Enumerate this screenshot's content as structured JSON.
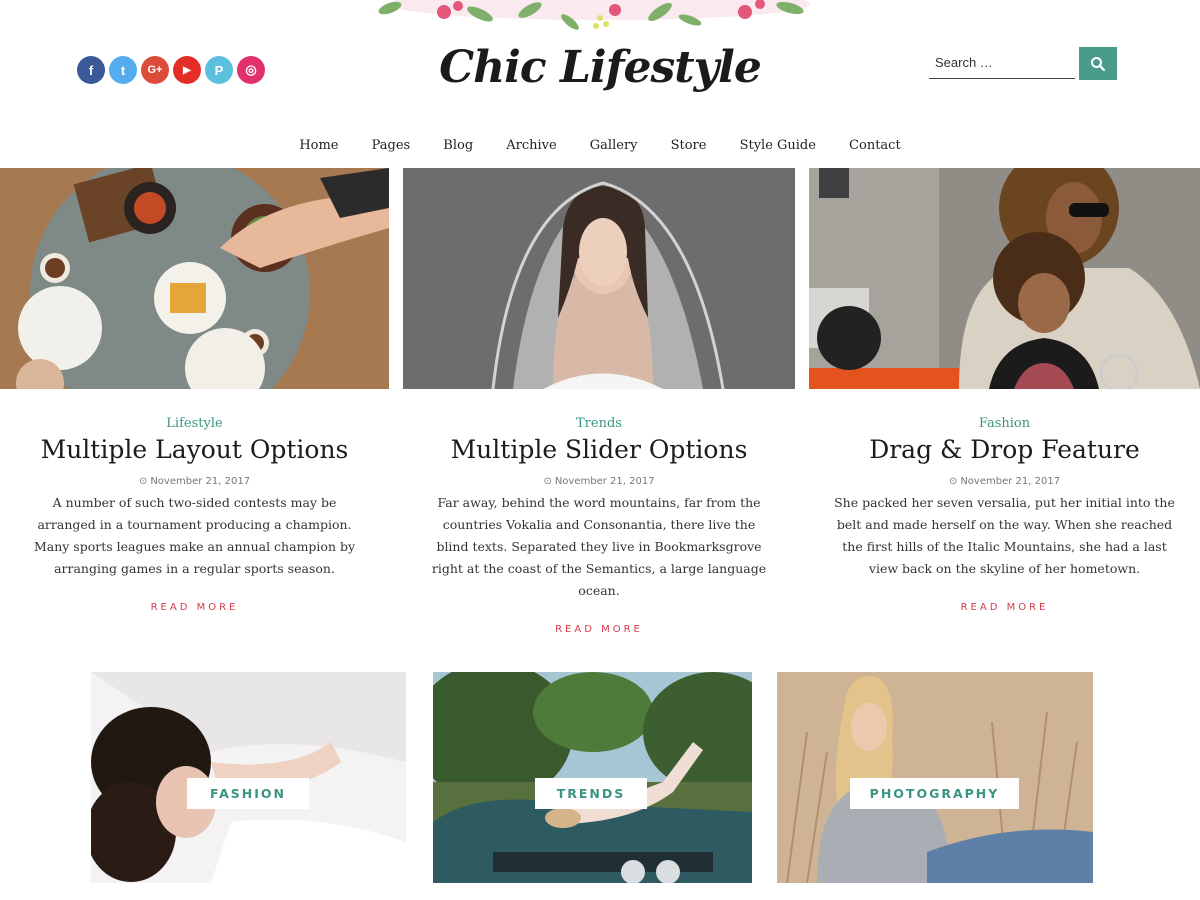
{
  "site": {
    "logo": "Chic Lifestyle"
  },
  "social": [
    {
      "icon": "facebook-icon",
      "glyph": "f",
      "color": "#3b5998"
    },
    {
      "icon": "twitter-icon",
      "glyph": "t",
      "color": "#55acee"
    },
    {
      "icon": "google-plus-icon",
      "glyph": "G+",
      "color": "#dd4b39"
    },
    {
      "icon": "youtube-icon",
      "glyph": "▶",
      "color": "#e52d27"
    },
    {
      "icon": "pinterest-icon",
      "glyph": "P",
      "color": "#5bc0de"
    },
    {
      "icon": "instagram-icon",
      "glyph": "◎",
      "color": "#e1306c"
    }
  ],
  "search": {
    "placeholder": "Search …"
  },
  "nav": [
    "Home",
    "Pages",
    "Blog",
    "Archive",
    "Gallery",
    "Store",
    "Style Guide",
    "Contact"
  ],
  "posts": [
    {
      "category": "Lifestyle",
      "title": "Multiple Layout Options",
      "date": "November 21, 2017",
      "excerpt": "A number of such two-sided contests may be arranged in a tournament producing a champion. Many sports leagues make an annual champion by arranging games in a regular sports season.",
      "more": "READ MORE"
    },
    {
      "category": "Trends",
      "title": "Multiple Slider Options",
      "date": "November 21, 2017",
      "excerpt": "Far away, behind the word mountains, far from the countries Vokalia and Consonantia, there live the blind texts. Separated they live in Bookmarksgrove right at the coast of the Semantics, a large language ocean.",
      "more": "READ MORE"
    },
    {
      "category": "Fashion",
      "title": "Drag & Drop Feature",
      "date": "November 21, 2017",
      "excerpt": "She packed her seven versalia, put her initial into the belt and made herself on the way. When she reached the first hills of the Italic Mountains, she had a last view back on the skyline of her hometown.",
      "more": "READ MORE"
    }
  ],
  "categories": [
    "FASHION",
    "TRENDS",
    "PHOTOGRAPHY"
  ],
  "colors": {
    "accent": "#3b9482",
    "read_more": "#d33b4b",
    "search_button": "#4a9b8c"
  }
}
